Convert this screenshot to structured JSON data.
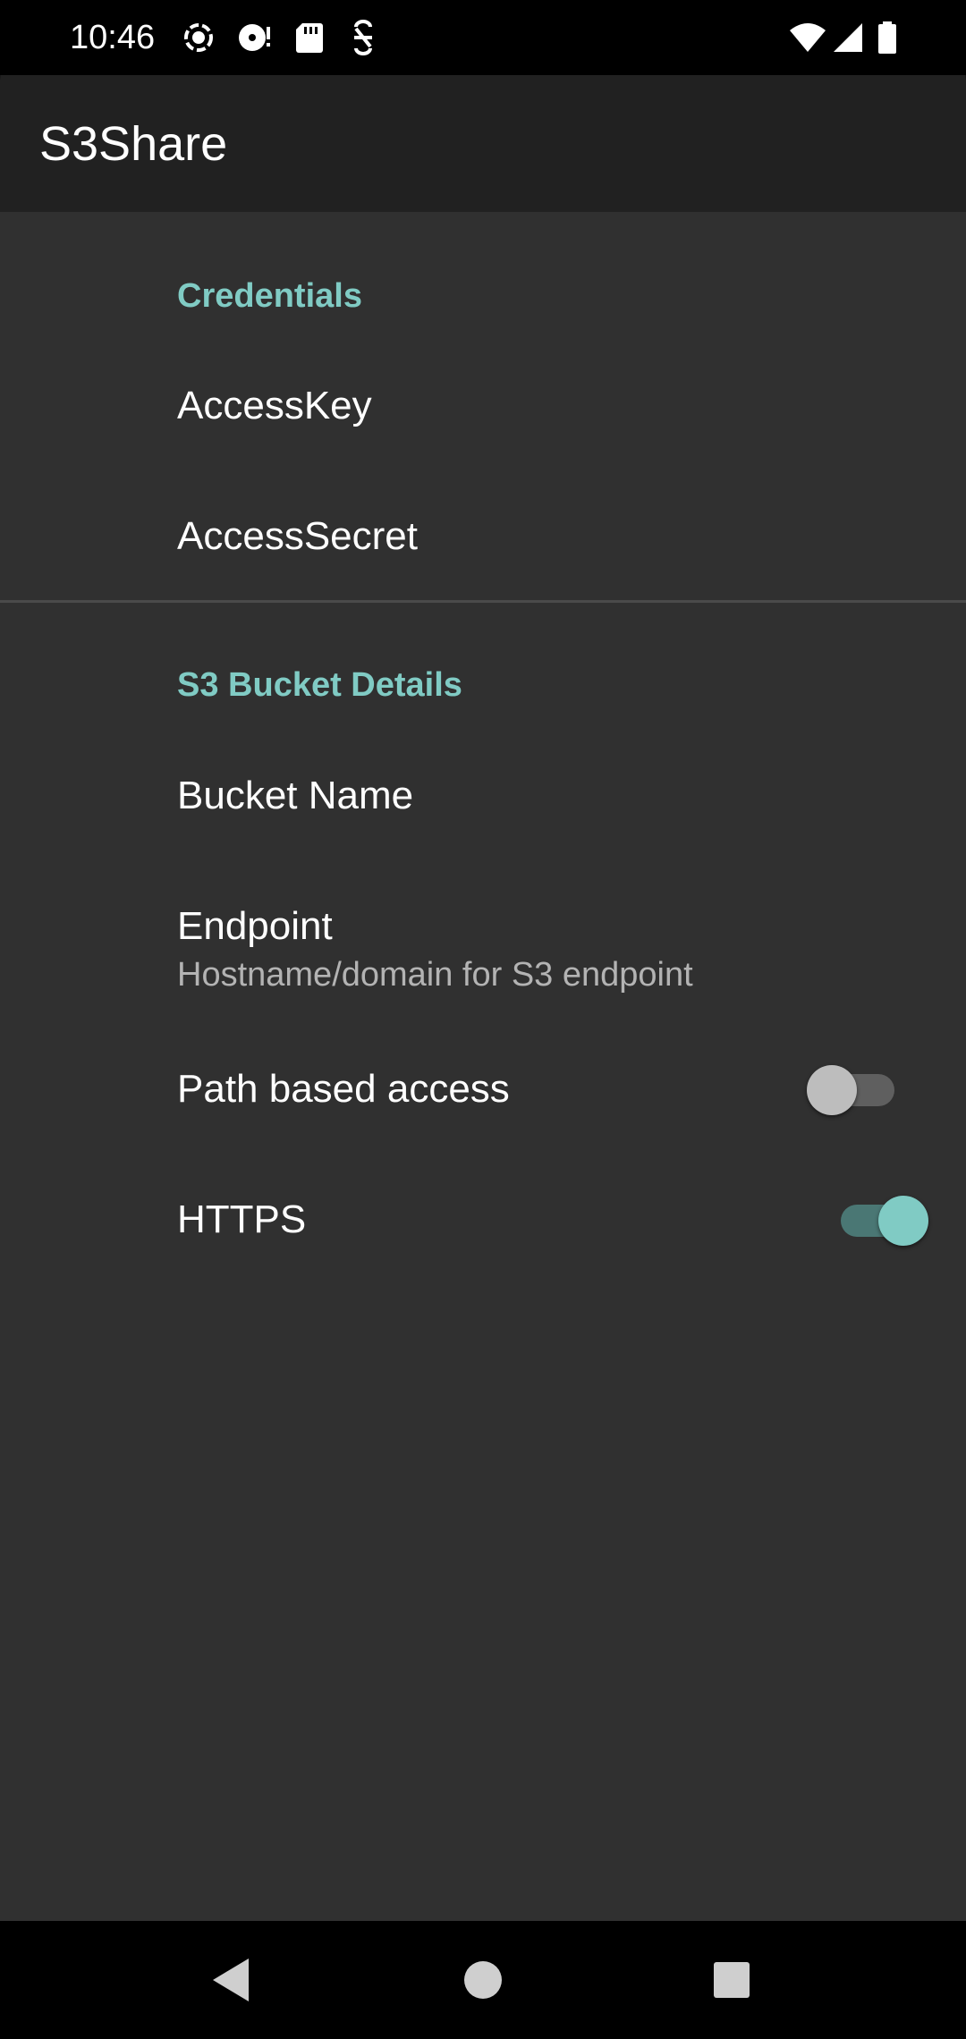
{
  "status_bar": {
    "time": "10:46",
    "icons": [
      "screen-record-icon",
      "disc-icon",
      "sd-card-icon",
      "accessibility-icon",
      "wifi-icon",
      "signal-icon",
      "battery-icon"
    ]
  },
  "app_bar": {
    "title": "S3Share"
  },
  "sections": {
    "credentials": {
      "header": "Credentials",
      "access_key": "AccessKey",
      "access_secret": "AccessSecret"
    },
    "bucket": {
      "header": "S3 Bucket Details",
      "bucket_name": "Bucket Name",
      "endpoint_title": "Endpoint",
      "endpoint_summary": "Hostname/domain for S3 endpoint",
      "path_access_title": "Path based access",
      "path_access_enabled": false,
      "https_title": "HTTPS",
      "https_enabled": true
    }
  },
  "colors": {
    "accent": "#80cbc4",
    "background": "#303030",
    "app_bar": "#212121"
  },
  "nav_bar": {
    "icons": [
      "back-icon",
      "home-icon",
      "recents-icon"
    ]
  }
}
